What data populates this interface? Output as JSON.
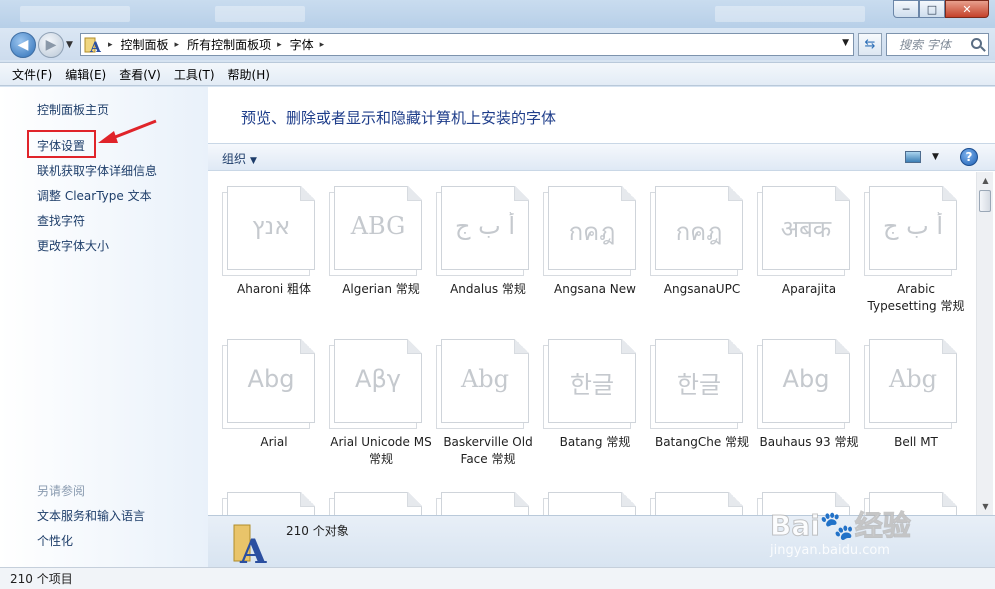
{
  "window": {
    "minimize": "─",
    "maximize": "□",
    "close": "✕"
  },
  "address": {
    "crumbs": [
      "控制面板",
      "所有控制面板项",
      "字体"
    ],
    "separator": "▸",
    "search_placeholder": "搜索 字体"
  },
  "menu": [
    "文件(F)",
    "编辑(E)",
    "查看(V)",
    "工具(T)",
    "帮助(H)"
  ],
  "left": {
    "links": [
      "控制面板主页",
      "字体设置",
      "联机获取字体详细信息",
      "调整 ClearType 文本",
      "查找字符",
      "更改字体大小"
    ],
    "see_also_heading": "另请参阅",
    "see_also": [
      "文本服务和输入语言",
      "个性化"
    ]
  },
  "main": {
    "title": "预览、删除或者显示和隐藏计算机上安装的字体",
    "organize": "组织",
    "help": "?",
    "fonts": [
      {
        "name": "Aharoni 粗体",
        "sample": "אנץ"
      },
      {
        "name": "Algerian 常规",
        "sample": "ABG"
      },
      {
        "name": "Andalus 常规",
        "sample": "أ ب ج"
      },
      {
        "name": "Angsana New",
        "sample": "กคฎ"
      },
      {
        "name": "AngsanaUPC",
        "sample": "กคฎ"
      },
      {
        "name": "Aparajita",
        "sample": "अबक"
      },
      {
        "name": "Arabic Typesetting 常规",
        "sample": "أ ب ج"
      },
      {
        "name": "Arial",
        "sample": "Abg"
      },
      {
        "name": "Arial Unicode MS 常规",
        "sample": "Aβγ"
      },
      {
        "name": "Baskerville Old Face 常规",
        "sample": "Abg"
      },
      {
        "name": "Batang 常规",
        "sample": "한글"
      },
      {
        "name": "BatangChe 常规",
        "sample": "한글"
      },
      {
        "name": "Bauhaus 93 常规",
        "sample": "Abg"
      },
      {
        "name": "Bell MT",
        "sample": "Abg"
      }
    ],
    "object_count": "210 个对象"
  },
  "status": "210 个项目",
  "watermark": {
    "text": "Bai  经验",
    "url": "jingyan.baidu.com"
  }
}
